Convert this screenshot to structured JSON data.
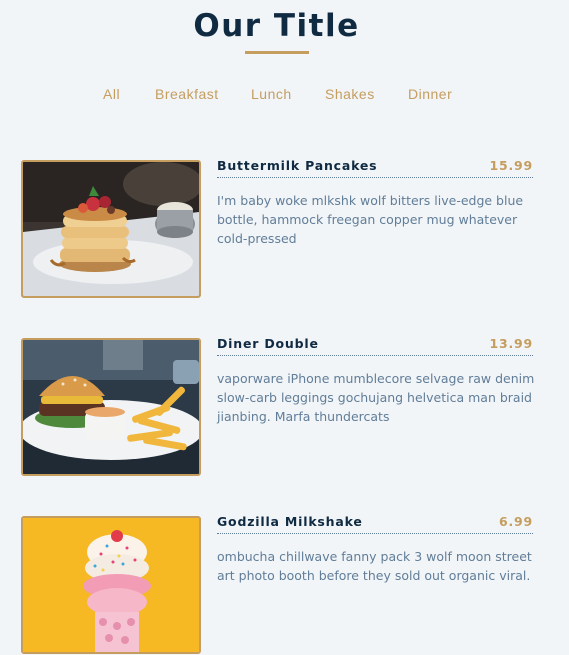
{
  "header": {
    "title": "Our Title"
  },
  "filters": [
    {
      "label": "All"
    },
    {
      "label": "Breakfast"
    },
    {
      "label": "Lunch"
    },
    {
      "label": "Shakes"
    },
    {
      "label": "Dinner"
    }
  ],
  "menu": [
    {
      "name": "Buttermilk Pancakes",
      "price": "15.99",
      "description": "I'm baby woke mlkshk wolf bitters live-edge blue bottle, hammock freegan copper mug whatever cold-pressed",
      "image": "pancakes-photo"
    },
    {
      "name": "Diner Double",
      "price": "13.99",
      "description": "vaporware iPhone mumblecore selvage raw denim slow-carb leggings gochujang helvetica man braid jianbing. Marfa thundercats",
      "image": "burger-photo"
    },
    {
      "name": "Godzilla Milkshake",
      "price": "6.99",
      "description": "ombucha chillwave fanny pack 3 wolf moon street art photo booth before they sold out organic viral.",
      "image": "milkshake-photo"
    }
  ],
  "colors": {
    "background": "#f1f5f8",
    "accent": "#c59d5f",
    "heading": "#102a42",
    "body_text": "#617d98"
  }
}
